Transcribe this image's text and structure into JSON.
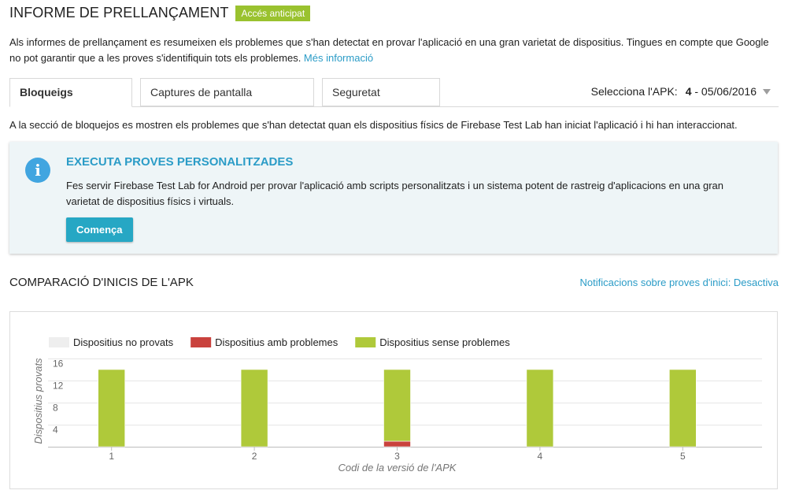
{
  "header": {
    "title": "INFORME DE PRELLANÇAMENT",
    "badge": "Accés anticipat"
  },
  "intro": {
    "text": "Als informes de prellançament es resumeixen els problemes que s'han detectat en provar l'aplicació en una gran varietat de dispositius. Tingues en compte que Google no pot garantir que a les proves s'identifiquin tots els problemes. ",
    "link": "Més informació"
  },
  "tabs": [
    {
      "label": "Bloqueigs",
      "active": true
    },
    {
      "label": "Captures de pantalla",
      "active": false
    },
    {
      "label": "Seguretat",
      "active": false
    }
  ],
  "apk_select": {
    "label": "Selecciona l'APK:",
    "version": "4",
    "date": " - 05/06/2016"
  },
  "crash_description": "A la secció de bloquejos es mostren els problemes que s'han detectat quan els dispositius físics de Firebase Test Lab han iniciat l'aplicació i hi han interaccionat.",
  "info_card": {
    "icon": "info-icon",
    "icon_glyph": "i",
    "title": "EXECUTA PROVES PERSONALITZADES",
    "text": "Fes servir Firebase Test Lab for Android per provar l'aplicació amb scripts personalitzats i un sistema potent de rastreig d'aplicacions en una gran varietat de dispositius físics i virtuals.",
    "button": "Comença"
  },
  "comparison": {
    "title": "COMPARACIÓ D'INICIS DE L'APK",
    "notifications": "Notificacions sobre proves d'inici: Desactiva"
  },
  "colors": {
    "accent": "#2b9cc7",
    "badge": "#9ac22f",
    "button": "#26a7c4",
    "untested": "#eeeeee",
    "problems": "#c9423d",
    "no_problems": "#afc93a"
  },
  "chart_data": {
    "type": "bar",
    "stacked": true,
    "categories": [
      "1",
      "2",
      "3",
      "4",
      "5"
    ],
    "series": [
      {
        "name": "Dispositius no provats",
        "color": "#eeeeee",
        "values": [
          0,
          0,
          0,
          0,
          0
        ]
      },
      {
        "name": "Dispositius amb problemes",
        "color": "#c9423d",
        "values": [
          0,
          0,
          1,
          0,
          0
        ]
      },
      {
        "name": "Dispositius sense problemes",
        "color": "#afc93a",
        "values": [
          14,
          14,
          13,
          14,
          14
        ]
      }
    ],
    "xlabel": "Codi de la versió de l'APK",
    "ylabel": "Dispositius provats",
    "yticks": [
      4,
      8,
      12,
      16
    ],
    "ylim": [
      0,
      16
    ],
    "grid": true,
    "legend_position": "top-left"
  }
}
